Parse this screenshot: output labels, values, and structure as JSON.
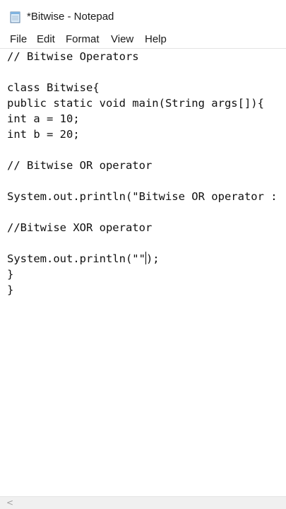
{
  "window": {
    "title": "*Bitwise - Notepad",
    "app_icon": "notepad-icon"
  },
  "menu": [
    {
      "label": "File"
    },
    {
      "label": "Edit"
    },
    {
      "label": "Format"
    },
    {
      "label": "View"
    },
    {
      "label": "Help"
    }
  ],
  "editor": {
    "lines": [
      "// Bitwise Operators",
      "",
      "class Bitwise{",
      "public static void main(String args[]){",
      "int a = 10;",
      "int b = 20;",
      "",
      "// Bitwise OR operator",
      "",
      "System.out.println(\"Bitwise OR operator :",
      "",
      "//Bitwise XOR operator",
      "",
      "System.out.println(\"\"",
      "}",
      "}"
    ],
    "caret_line_suffix": ");"
  },
  "scrollbar": {
    "left_arrow": "<",
    "arrow_icon": "chevron-left-icon"
  }
}
